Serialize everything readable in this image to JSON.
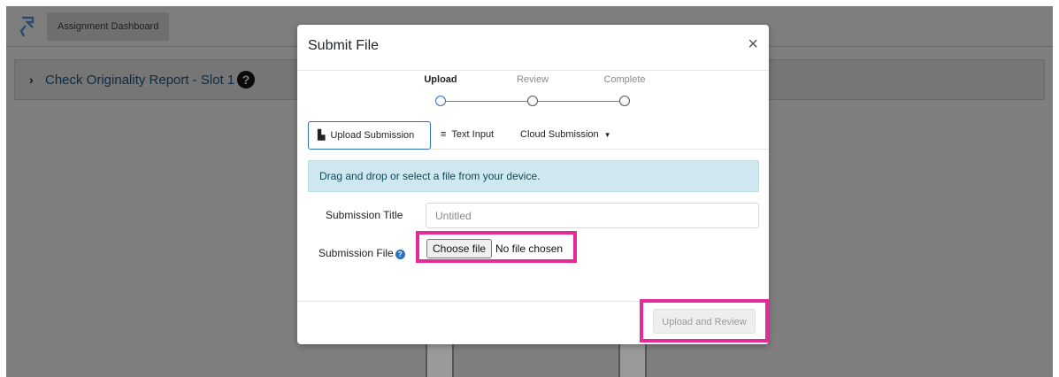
{
  "background_page": {
    "tab_label": "Assignment Dashboard",
    "panel_title": "Check Originality Report - Slot 1",
    "help_symbol": "?",
    "chevron_symbol": "›"
  },
  "modal": {
    "title": "Submit File",
    "close_symbol": "×",
    "steps": [
      {
        "label": "Upload",
        "active": true
      },
      {
        "label": "Review",
        "active": false
      },
      {
        "label": "Complete",
        "active": false
      }
    ],
    "tabs": [
      {
        "label": "Upload Submission",
        "icon": "file-icon",
        "selected": true
      },
      {
        "label": "Text Input",
        "icon": "align-left-icon",
        "selected": false
      },
      {
        "label": "Cloud Submission",
        "icon": "caret-down-icon",
        "selected": false
      }
    ],
    "info_message": "Drag and drop or select a file from your device.",
    "form": {
      "title_label": "Submission Title",
      "title_placeholder": "Untitled",
      "title_value": "",
      "file_label": "Submission File",
      "file_help_symbol": "?",
      "choose_file_label": "Choose file",
      "file_status": "No file chosen"
    },
    "submit_label": "Upload and Review"
  },
  "colors": {
    "highlight": "#e52a9a",
    "accent_blue": "#2b6fbf",
    "info_bg": "#cfe8ef",
    "overlay": "#7f7f7f"
  }
}
